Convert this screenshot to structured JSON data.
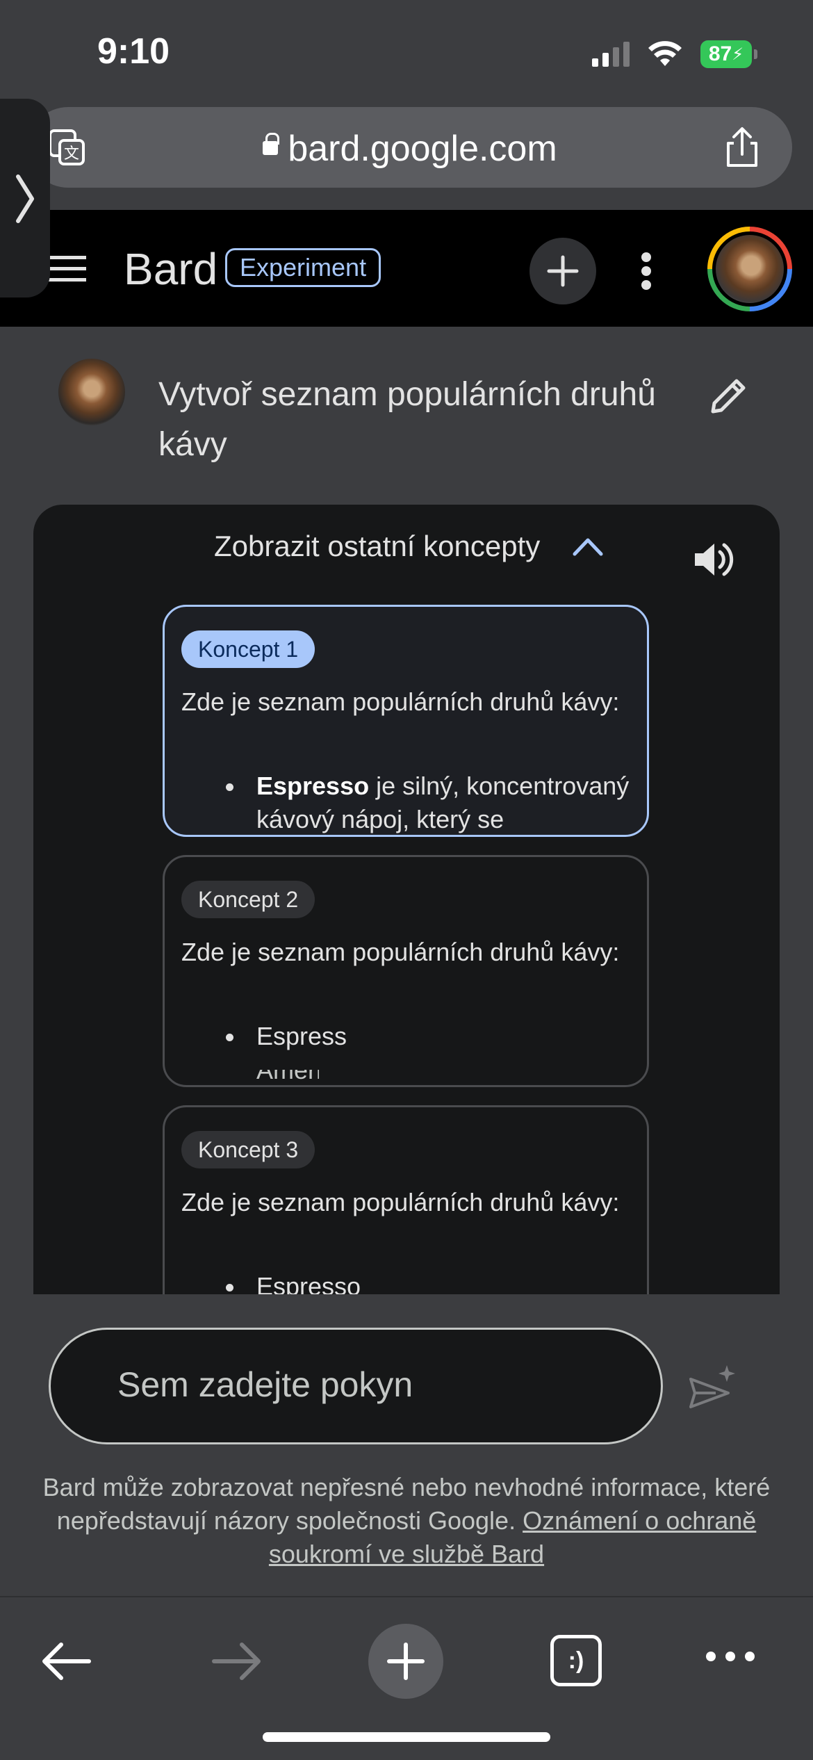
{
  "status_bar": {
    "time": "9:10",
    "battery": "87",
    "icons": [
      "signal-icon",
      "wifi-icon",
      "battery-charging-icon"
    ]
  },
  "browser": {
    "url": "bard.google.com",
    "icons": [
      "translate-icon",
      "lock-icon",
      "share-icon",
      "chevron-right-icon"
    ]
  },
  "app_header": {
    "brand": "Bard",
    "badge": "Experiment",
    "icons": [
      "menu-icon",
      "plus-icon",
      "more-vert-icon",
      "avatar"
    ]
  },
  "prompt": {
    "text": "Vytvoř seznam populárních druhů kávy"
  },
  "drafts": {
    "toggle_label": "Zobrazit ostatní koncepty",
    "items": [
      {
        "label": "Koncept 1",
        "intro": "Zde je seznam populárních druhů kávy:",
        "bullet_bold": "Espresso",
        "bullet_rest": " je silný, koncentrovaný kávový nápoj, který se"
      },
      {
        "label": "Koncept 2",
        "intro": "Zde je seznam populárních druhů kávy:",
        "bullet_bold": "",
        "bullet_rest": "Espress",
        "trail": "Americano"
      },
      {
        "label": "Koncept 3",
        "intro": "Zde je seznam populárních druhů kávy:",
        "bullet_bold": "",
        "bullet_rest": "Espresso"
      }
    ]
  },
  "input": {
    "placeholder": "Sem zadejte pokyn"
  },
  "disclaimer": {
    "text": "Bard může zobrazovat nepřesné nebo nevhodné informace, které nepředstavují názory společnosti Google. ",
    "link": "Oznámení o ochraně soukromí ve službě Bard"
  },
  "bottom_nav": {
    "tabs_label": ":)",
    "icons": [
      "back-arrow-icon",
      "forward-arrow-icon",
      "plus-icon",
      "tabs-icon",
      "more-horiz-icon"
    ]
  },
  "colors": {
    "accent": "#a8c7fa",
    "background": "#3c3d40",
    "header": "#000000",
    "panel": "#161718",
    "battery": "#34c759"
  }
}
